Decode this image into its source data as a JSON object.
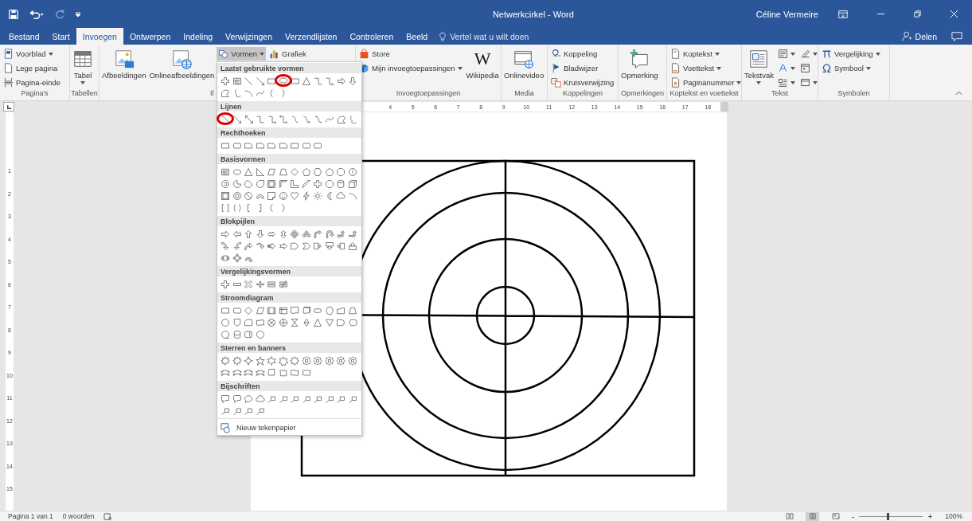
{
  "title_bar": {
    "title": "Netwerkcirkel  -  Word",
    "user": "Céline Vermeire"
  },
  "tabs": [
    {
      "label": "Bestand",
      "selected": false
    },
    {
      "label": "Start",
      "selected": false
    },
    {
      "label": "Invoegen",
      "selected": true
    },
    {
      "label": "Ontwerpen",
      "selected": false
    },
    {
      "label": "Indeling",
      "selected": false
    },
    {
      "label": "Verwijzingen",
      "selected": false
    },
    {
      "label": "Verzendlijsten",
      "selected": false
    },
    {
      "label": "Controleren",
      "selected": false
    },
    {
      "label": "Beeld",
      "selected": false
    }
  ],
  "tell_me": {
    "placeholder": "Vertel wat u wilt doen"
  },
  "share": "Delen",
  "ribbon_groups": [
    {
      "label": "Pagina's",
      "columns": [
        [
          {
            "label": "Voorblad",
            "kind": "small",
            "dropdown": true,
            "pressed": false
          },
          {
            "label": "Lege pagina",
            "kind": "small",
            "dropdown": false,
            "pressed": false
          },
          {
            "label": "Pagina-einde",
            "kind": "small",
            "dropdown": false,
            "pressed": false
          }
        ]
      ]
    },
    {
      "label": "Tabellen",
      "columns": [
        [
          {
            "label": "Tabel",
            "kind": "large",
            "dropdown": true,
            "pressed": false
          }
        ]
      ]
    },
    {
      "label": "Il",
      "columns": [
        [
          {
            "label": "Afbeeldingen",
            "kind": "large",
            "dropdown": false,
            "pressed": false
          }
        ],
        [
          {
            "label": "Onlineafbeeldingen",
            "kind": "large",
            "dropdown": false,
            "pressed": false
          }
        ],
        [
          {
            "label": "Vormen",
            "kind": "small",
            "dropdown": true,
            "pressed": true
          }
        ],
        [
          {
            "label": "Grafiek",
            "kind": "small",
            "dropdown": false,
            "pressed": false
          }
        ]
      ]
    },
    {
      "label": "Invoegtoepassingen",
      "columns": [
        [
          {
            "label": "Store",
            "kind": "small",
            "dropdown": false,
            "pressed": false
          },
          {
            "label": "Mijn invoegtoepassingen",
            "kind": "small",
            "dropdown": true,
            "pressed": false
          }
        ],
        [
          {
            "label": "Wikipedia",
            "kind": "large",
            "dropdown": false,
            "pressed": false,
            "icon_text": "W"
          }
        ]
      ]
    },
    {
      "label": "Media",
      "columns": [
        [
          {
            "label": "Onlinevideo",
            "kind": "large",
            "dropdown": false,
            "pressed": false
          }
        ]
      ]
    },
    {
      "label": "Koppelingen",
      "columns": [
        [
          {
            "label": "Koppeling",
            "kind": "small",
            "dropdown": false,
            "pressed": false
          },
          {
            "label": "Bladwijzer",
            "kind": "small",
            "dropdown": false,
            "pressed": false
          },
          {
            "label": "Kruisverwijzing",
            "kind": "small",
            "dropdown": false,
            "pressed": false
          }
        ]
      ]
    },
    {
      "label": "Opmerkingen",
      "columns": [
        [
          {
            "label": "Opmerking",
            "kind": "large",
            "dropdown": false,
            "pressed": false
          }
        ]
      ]
    },
    {
      "label": "Koptekst en voettekst",
      "columns": [
        [
          {
            "label": "Koptekst",
            "kind": "small",
            "dropdown": true,
            "pressed": false
          },
          {
            "label": "Voettekst",
            "kind": "small",
            "dropdown": true,
            "pressed": false
          },
          {
            "label": "Paginanummer",
            "kind": "small",
            "dropdown": true,
            "pressed": false
          }
        ]
      ]
    },
    {
      "label": "Tekst",
      "columns": [
        [
          {
            "label": "Tekstvak",
            "kind": "large",
            "dropdown": true,
            "pressed": false
          }
        ],
        [
          {
            "kind": "small",
            "dropdown": true,
            "pressed": false
          },
          {
            "kind": "small",
            "dropdown": true,
            "pressed": false
          },
          {
            "kind": "small",
            "dropdown": true,
            "pressed": false
          }
        ],
        [
          {
            "kind": "small",
            "dropdown": true,
            "pressed": false
          },
          {
            "kind": "small",
            "dropdown": false,
            "pressed": false
          },
          {
            "kind": "small",
            "dropdown": true,
            "pressed": false
          }
        ]
      ]
    },
    {
      "label": "Symbolen",
      "columns": [
        [
          {
            "label": "Vergelijking",
            "kind": "small",
            "dropdown": true,
            "pressed": false
          },
          {
            "label": "Symbool",
            "kind": "small",
            "dropdown": true,
            "pressed": false
          }
        ]
      ]
    }
  ],
  "shapes_menu": {
    "categories": [
      {
        "title": "Laatst gebruikte vormen",
        "shapes": [
          {
            "kind": "plus",
            "marked": false
          },
          {
            "kind": "textbox",
            "marked": false
          },
          {
            "kind": "line",
            "marked": false
          },
          {
            "kind": "arrow-line",
            "marked": false
          },
          {
            "kind": "rect",
            "marked": false
          },
          {
            "kind": "oval",
            "marked": true
          },
          {
            "kind": "rect",
            "marked": false
          },
          {
            "kind": "triangle",
            "marked": false
          },
          {
            "kind": "elbow",
            "marked": false
          },
          {
            "kind": "elbow-arrow",
            "marked": false
          },
          {
            "kind": "block-right",
            "marked": false
          },
          {
            "kind": "block-down",
            "marked": false
          },
          {
            "kind": "freeform",
            "marked": false
          },
          {
            "kind": "scribble",
            "marked": false
          },
          {
            "kind": "arc",
            "marked": false
          },
          {
            "kind": "curve",
            "marked": false
          },
          {
            "kind": "brace-left",
            "marked": false
          },
          {
            "kind": "brace-right",
            "marked": false
          }
        ]
      },
      {
        "title": "Lijnen",
        "shapes": [
          {
            "kind": "line",
            "marked": true
          },
          {
            "kind": "arrow-line",
            "marked": false
          },
          {
            "kind": "double-arrow-line",
            "marked": false
          },
          {
            "kind": "elbow",
            "marked": false
          },
          {
            "kind": "elbow-arrow",
            "marked": false
          },
          {
            "kind": "elbow-double",
            "marked": false
          },
          {
            "kind": "curve-connector",
            "marked": false
          },
          {
            "kind": "curve-arrow",
            "marked": false
          },
          {
            "kind": "curve-double",
            "marked": false
          },
          {
            "kind": "curve",
            "marked": false
          },
          {
            "kind": "freeform",
            "marked": false
          },
          {
            "kind": "scribble",
            "marked": false
          }
        ]
      },
      {
        "title": "Rechthoeken",
        "shapes": [
          {
            "kind": "rect",
            "marked": false
          },
          {
            "kind": "roundrect",
            "marked": false
          },
          {
            "kind": "snip",
            "marked": false
          },
          {
            "kind": "snip",
            "marked": false
          },
          {
            "kind": "snip",
            "marked": false
          },
          {
            "kind": "snip",
            "marked": false
          },
          {
            "kind": "rect",
            "marked": false
          },
          {
            "kind": "roundrect",
            "marked": false
          },
          {
            "kind": "roundrect",
            "marked": false
          }
        ]
      },
      {
        "title": "Basisvormen",
        "shapes": [
          {
            "kind": "textbox",
            "marked": false
          },
          {
            "kind": "oval",
            "marked": false
          },
          {
            "kind": "triangle",
            "marked": false
          },
          {
            "kind": "rtriangle",
            "marked": false
          },
          {
            "kind": "parallelogram",
            "marked": false
          },
          {
            "kind": "trapezoid",
            "marked": false
          },
          {
            "kind": "diamond",
            "marked": false
          },
          {
            "kind": "pentagon",
            "marked": false
          },
          {
            "kind": "hexagon",
            "marked": false
          },
          {
            "kind": "heptagon",
            "marked": false
          },
          {
            "kind": "octagon",
            "marked": false
          },
          {
            "kind": "decagon",
            "marked": false
          },
          {
            "kind": "dodecagon",
            "marked": false
          },
          {
            "kind": "pie",
            "marked": false
          },
          {
            "kind": "chord",
            "marked": false
          },
          {
            "kind": "teardrop",
            "marked": false
          },
          {
            "kind": "frame",
            "marked": false
          },
          {
            "kind": "halfframe",
            "marked": false
          },
          {
            "kind": "lshape",
            "marked": false
          },
          {
            "kind": "diagstripe",
            "marked": false
          },
          {
            "kind": "plus",
            "marked": false
          },
          {
            "kind": "octagon",
            "marked": false
          },
          {
            "kind": "cylinder",
            "marked": false
          },
          {
            "kind": "cube",
            "marked": false
          },
          {
            "kind": "bevel",
            "marked": false
          },
          {
            "kind": "donut",
            "marked": false
          },
          {
            "kind": "nosymbol",
            "marked": false
          },
          {
            "kind": "blockarc",
            "marked": false
          },
          {
            "kind": "foldedcorner",
            "marked": false
          },
          {
            "kind": "smiley",
            "marked": false
          },
          {
            "kind": "heart",
            "marked": false
          },
          {
            "kind": "lightning",
            "marked": false
          },
          {
            "kind": "sun",
            "marked": false
          },
          {
            "kind": "moon",
            "marked": false
          },
          {
            "kind": "cloud",
            "marked": false
          },
          {
            "kind": "arc",
            "marked": false
          },
          {
            "kind": "bracket-pair",
            "marked": false
          },
          {
            "kind": "brace-pair",
            "marked": false
          },
          {
            "kind": "bracket-left",
            "marked": false
          },
          {
            "kind": "bracket-right",
            "marked": false
          },
          {
            "kind": "brace-left",
            "marked": false
          },
          {
            "kind": "brace-right",
            "marked": false
          }
        ]
      },
      {
        "title": "Blokpijlen",
        "shapes": [
          {
            "kind": "block-right",
            "marked": false
          },
          {
            "kind": "block-left",
            "marked": false
          },
          {
            "kind": "block-up",
            "marked": false
          },
          {
            "kind": "block-down",
            "marked": false
          },
          {
            "kind": "block-leftright",
            "marked": false
          },
          {
            "kind": "block-updown",
            "marked": false
          },
          {
            "kind": "block-quad",
            "marked": false
          },
          {
            "kind": "block-leftrightup",
            "marked": false
          },
          {
            "kind": "bent-arrow",
            "marked": false
          },
          {
            "kind": "uturn",
            "marked": false
          },
          {
            "kind": "block-leftup",
            "marked": false
          },
          {
            "kind": "block-bentup",
            "marked": false
          },
          {
            "kind": "curved-right",
            "marked": false
          },
          {
            "kind": "curved-left",
            "marked": false
          },
          {
            "kind": "curved-up",
            "marked": false
          },
          {
            "kind": "curved-down",
            "marked": false
          },
          {
            "kind": "striped-right",
            "marked": false
          },
          {
            "kind": "notched-right",
            "marked": false
          },
          {
            "kind": "pentagon-arrow",
            "marked": false
          },
          {
            "kind": "chevron",
            "marked": false
          },
          {
            "kind": "callout-right",
            "marked": false
          },
          {
            "kind": "callout-down",
            "marked": false
          },
          {
            "kind": "callout-left",
            "marked": false
          },
          {
            "kind": "callout-up",
            "marked": false
          },
          {
            "kind": "callout-leftright",
            "marked": false
          },
          {
            "kind": "callout-quad",
            "marked": false
          },
          {
            "kind": "circular-arrow",
            "marked": false
          }
        ]
      },
      {
        "title": "Vergelijkingsvormen",
        "shapes": [
          {
            "kind": "plus",
            "marked": false
          },
          {
            "kind": "minus",
            "marked": false
          },
          {
            "kind": "multiply",
            "marked": false
          },
          {
            "kind": "divide",
            "marked": false
          },
          {
            "kind": "equal",
            "marked": false
          },
          {
            "kind": "notequal",
            "marked": false
          }
        ]
      },
      {
        "title": "Stroomdiagram",
        "shapes": [
          {
            "kind": "rect",
            "marked": false
          },
          {
            "kind": "roundrect",
            "marked": false
          },
          {
            "kind": "diamond",
            "marked": false
          },
          {
            "kind": "parallelogram",
            "marked": false
          },
          {
            "kind": "predefined",
            "marked": false
          },
          {
            "kind": "internal",
            "marked": false
          },
          {
            "kind": "document",
            "marked": false
          },
          {
            "kind": "multidoc",
            "marked": false
          },
          {
            "kind": "terminator",
            "marked": false
          },
          {
            "kind": "hexagon",
            "marked": false
          },
          {
            "kind": "manualinput",
            "marked": false
          },
          {
            "kind": "trapezoid",
            "marked": false
          },
          {
            "kind": "circle",
            "marked": false
          },
          {
            "kind": "offpage",
            "marked": false
          },
          {
            "kind": "card",
            "marked": false
          },
          {
            "kind": "tape",
            "marked": false
          },
          {
            "kind": "cross-circle",
            "marked": false
          },
          {
            "kind": "plus-circle",
            "marked": false
          },
          {
            "kind": "hourglass",
            "marked": false
          },
          {
            "kind": "sort",
            "marked": false
          },
          {
            "kind": "triangle",
            "marked": false
          },
          {
            "kind": "merge",
            "marked": false
          },
          {
            "kind": "delay",
            "marked": false
          },
          {
            "kind": "display",
            "marked": false
          },
          {
            "kind": "sequential",
            "marked": false
          },
          {
            "kind": "disk",
            "marked": false
          },
          {
            "kind": "direct",
            "marked": false
          },
          {
            "kind": "circle",
            "marked": false
          }
        ]
      },
      {
        "title": "Sterren en banners",
        "shapes": [
          {
            "kind": "burst",
            "marked": false
          },
          {
            "kind": "burst",
            "marked": false
          },
          {
            "kind": "star4",
            "marked": false
          },
          {
            "kind": "star",
            "marked": false
          },
          {
            "kind": "star6",
            "marked": false
          },
          {
            "kind": "star7",
            "marked": false
          },
          {
            "kind": "star8",
            "marked": false
          },
          {
            "kind": "seal",
            "marked": false
          },
          {
            "kind": "seal",
            "marked": false
          },
          {
            "kind": "seal",
            "marked": false
          },
          {
            "kind": "seal",
            "marked": false
          },
          {
            "kind": "seal",
            "marked": false
          },
          {
            "kind": "ribbon",
            "marked": false
          },
          {
            "kind": "ribbon",
            "marked": false
          },
          {
            "kind": "ribbon",
            "marked": false
          },
          {
            "kind": "ribbon",
            "marked": false
          },
          {
            "kind": "scroll",
            "marked": false
          },
          {
            "kind": "scroll-h",
            "marked": false
          },
          {
            "kind": "wave",
            "marked": false
          },
          {
            "kind": "doublewave",
            "marked": false
          }
        ]
      },
      {
        "title": "Bijschriften",
        "shapes": [
          {
            "kind": "callout-rect",
            "marked": false
          },
          {
            "kind": "callout-roundrect",
            "marked": false
          },
          {
            "kind": "callout-oval",
            "marked": false
          },
          {
            "kind": "cloud",
            "marked": false
          },
          {
            "kind": "callout-line",
            "marked": false
          },
          {
            "kind": "callout-line",
            "marked": false
          },
          {
            "kind": "callout-line",
            "marked": false
          },
          {
            "kind": "callout-line",
            "marked": false
          },
          {
            "kind": "callout-line",
            "marked": false
          },
          {
            "kind": "callout-line",
            "marked": false
          },
          {
            "kind": "callout-line",
            "marked": false
          },
          {
            "kind": "callout-line",
            "marked": false
          },
          {
            "kind": "callout-line",
            "marked": false
          },
          {
            "kind": "callout-line",
            "marked": false
          },
          {
            "kind": "callout-line",
            "marked": false
          },
          {
            "kind": "callout-line",
            "marked": false
          }
        ]
      }
    ],
    "footer": "Nieuw tekenpapier"
  },
  "horizontal_ruler": [
    "4",
    "5",
    "6",
    "7",
    "8",
    "9",
    "10",
    "11",
    "12",
    "13",
    "14",
    "15",
    "16",
    "17",
    "18"
  ],
  "vertical_ruler": [
    "1",
    "2",
    "3",
    "4",
    "5",
    "6",
    "7",
    "8",
    "9",
    "10",
    "11",
    "12",
    "13",
    "14",
    "15"
  ],
  "status_bar": {
    "page": "Pagina 1 van 1",
    "words": "0 woorden",
    "views": [
      {
        "selected": false
      },
      {
        "selected": true
      },
      {
        "selected": false
      }
    ],
    "zoom_minus": "-",
    "zoom_plus": "+",
    "zoom": {
      "level": 0.45
    },
    "zoom_text": "100%"
  }
}
